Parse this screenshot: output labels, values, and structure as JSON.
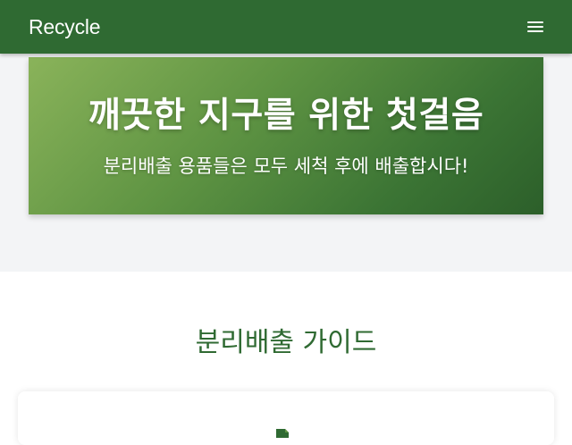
{
  "navbar": {
    "brand": "Recycle",
    "menu_icon": "hamburger-icon"
  },
  "hero": {
    "title": "깨끗한 지구를 위한 첫걸음",
    "subtitle": "분리배출 용품들은 모두 세척 후에 배출합시다!"
  },
  "guide": {
    "title": "분리배출 가이드",
    "card_icon": "document-icon"
  },
  "colors": {
    "primary": "#2f6a32",
    "hero_gradient_start": "#8ab35a",
    "hero_gradient_end": "#2c5f2a",
    "section_bg": "#f3f4f6"
  }
}
